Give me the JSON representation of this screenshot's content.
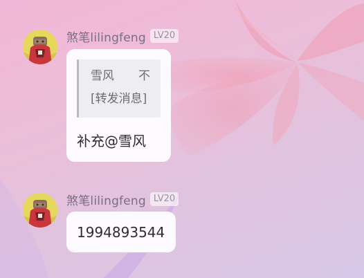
{
  "messages": [
    {
      "sender": "煞笔lilingfeng",
      "level": "LV20",
      "quote": {
        "name": "雪风",
        "tail": "不",
        "body": "[转发消息]"
      },
      "text": "补充@雪风"
    },
    {
      "sender": "煞笔lilingfeng",
      "level": "LV20",
      "text": "1994893544"
    }
  ],
  "colors": {
    "bubble": "#fdfbff",
    "quote_bg": "#eeedf1",
    "sender": "#7b6d86",
    "text": "#2e2b33"
  },
  "icons": {
    "avatar": "character-avatar"
  }
}
